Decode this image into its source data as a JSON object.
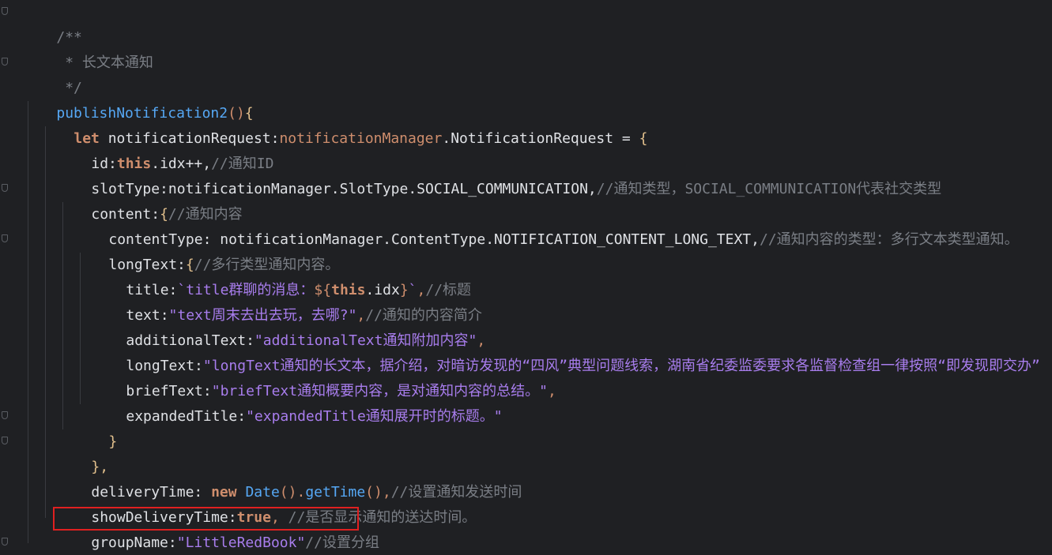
{
  "colors": {
    "background": "#1f2023",
    "keyword": "#cf8e6d",
    "function": "#56a8f5",
    "comment": "#7a7e85",
    "string": "#a87ded",
    "text": "#bcbec4",
    "highlight_box": "#e02020"
  },
  "code": {
    "l1": "/**",
    "l2": " * 长文本通知",
    "l3": " */",
    "l4_fn": "publishNotification2",
    "l4_paren": "()",
    "l4_brace": "{",
    "l5_kw": "let",
    "l5_var": " notificationRequest:",
    "l5_ns": "notificationManager",
    "l5_type": ".NotificationRequest = ",
    "l5_brace": "{",
    "l6_key": "id:",
    "l6_this": "this",
    "l6_val": ".idx++,",
    "l6_cm": "//通知ID",
    "l7_key": "slotType:",
    "l7_val": "notificationManager.SlotType.SOCIAL_COMMUNICATION,",
    "l7_cm": "//通知类型，SOCIAL_COMMUNICATION代表社交类型",
    "l8_key": "content:",
    "l8_brace": "{",
    "l8_cm": "//通知内容",
    "l9_key": "contentType: ",
    "l9_val": "notificationManager.ContentType.NOTIFICATION_CONTENT_LONG_TEXT,",
    "l9_cm": "//通知内容的类型：多行文本类型通知。",
    "l10_key": "longText:",
    "l10_brace": "{",
    "l10_cm": "//多行类型通知内容。",
    "l11_key": "title:",
    "l11_str1": "`title群聊的消息：",
    "l11_tpl1": "${",
    "l11_this": "this",
    "l11_idx": ".idx",
    "l11_tpl2": "}",
    "l11_str2": "`",
    "l11_comma": ",",
    "l11_cm": "//标题",
    "l12_key": "text:",
    "l12_str": "\"text周末去出去玩，去哪?\"",
    "l12_comma": ",",
    "l12_cm": "//通知的内容简介",
    "l13_key": "additionalText:",
    "l13_str": "\"additionalText通知附加内容\"",
    "l13_comma": ",",
    "l14_key": "longText:",
    "l14_str": "\"longText通知的长文本，据介绍，对暗访发现的“四风”典型问题线索，湖南省纪委监委要求各监督检查组一律按照“即发现即交办”",
    "l15_key": "briefText:",
    "l15_str": "\"briefText通知概要内容，是对通知内容的总结。\"",
    "l15_comma": ",",
    "l16_key": "expandedTitle:",
    "l16_str": "\"expandedTitle通知展开时的标题。\"",
    "l17": "}",
    "l18": "},",
    "l19_key": "deliveryTime: ",
    "l19_new": "new ",
    "l19_date": "Date",
    "l19_p1": "().",
    "l19_fn": "getTime",
    "l19_p2": "(),",
    "l19_cm": "//设置通知发送时间",
    "l20_key": "showDeliveryTime:",
    "l20_val": "true",
    "l20_comma": ", ",
    "l20_cm": "//是否显示通知的送达时间。",
    "l21_key": "groupName:",
    "l21_str": "\"LittleRedBook\"",
    "l21_cm": "//设置分组",
    "l22": "}"
  }
}
